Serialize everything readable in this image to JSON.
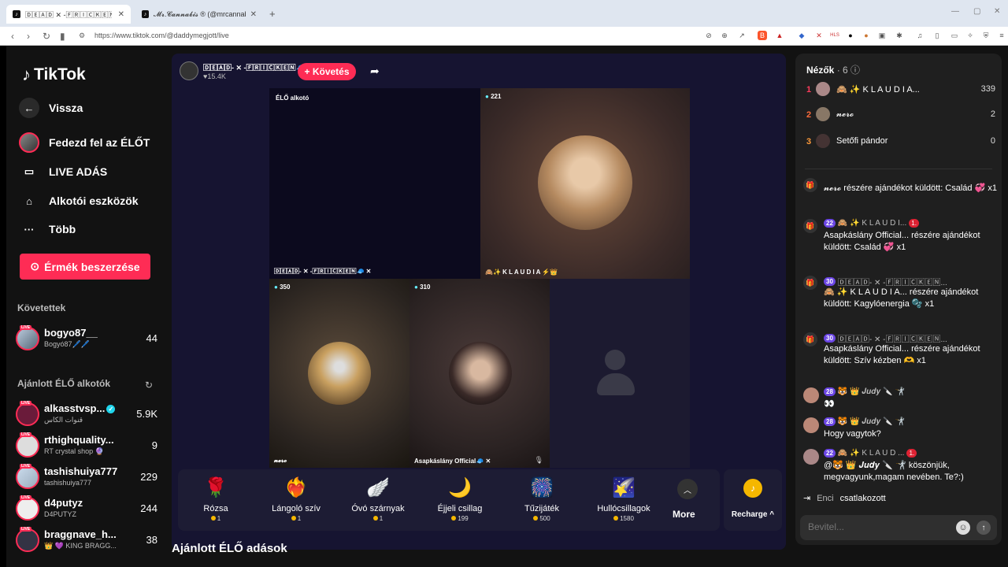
{
  "browser": {
    "tabs": [
      {
        "title": "🄳🄴🄰🄳 ✕ -🄵🅁🄸🄲🄺🄴🄽🧢 (@d"
      },
      {
        "title": "𝓜𝓻.𝓒𝓪𝓷𝓷𝓪𝓫𝓲𝓼 ® (@mrcannabis_"
      }
    ],
    "new_tab": "+",
    "url": "https://www.tiktok.com/@daddymegjott/live"
  },
  "sidebar": {
    "logo": "TikTok",
    "menu": [
      {
        "label": "Vissza",
        "icon": "back-arrow-icon"
      },
      {
        "label": "Fedezd fel az ÉLŐT",
        "icon": "avatar"
      },
      {
        "label": "LIVE ADÁS",
        "icon": "camera-icon"
      },
      {
        "label": "Alkotói eszközök",
        "icon": "creator-tools-icon"
      },
      {
        "label": "Több",
        "icon": "more-icon"
      }
    ],
    "coins_button": "Érmék beszerzése",
    "followed_title": "Követettek",
    "followed": [
      {
        "name": "bogyo87__",
        "sub": "Bogyó87🖊️🖊️",
        "count": "44"
      }
    ],
    "recommended_title": "Ajánlott ÉLŐ alkotók",
    "recommended": [
      {
        "name": "alkasstvsp...",
        "sub": "قنوات الكاس",
        "count": "5.9K",
        "verified": true
      },
      {
        "name": "rthighquality...",
        "sub": "RT crystal shop 🔮",
        "count": "9"
      },
      {
        "name": "tashishuiya777",
        "sub": "tashishuiya777",
        "count": "229"
      },
      {
        "name": "d4putyz",
        "sub": "D4PUTYZ",
        "count": "244"
      },
      {
        "name": "braggnave_h...",
        "sub": "👑 💜 KING BRAGG...",
        "count": "38"
      }
    ]
  },
  "stream": {
    "host_name": "🄳🄴🄰🄳- ✕ -🄵🅁🄸🄲🄺🄴🄽🧢 ✕",
    "host_likes": "15.4K",
    "follow_label": "+ Követés",
    "creator_label": "ÉLŐ alkotó",
    "host_tag": "🄳🄴🄰🄳- ✕ -🄵🅁🄸🄲🄺🄴🄽🧢 ✕",
    "guests": [
      {
        "count": "221",
        "name": "🙈✨ K L A U D I A ⚡👑"
      },
      {
        "count": "350",
        "name": "𝓷𝓮𝓻𝓸"
      },
      {
        "count": "310",
        "name": "Asapkáslány Official🧢 ✕"
      }
    ]
  },
  "gifts": {
    "items": [
      {
        "name": "Rózsa",
        "price": "1",
        "icon": "🌹"
      },
      {
        "name": "Lángoló szív",
        "price": "1",
        "icon": "❤️‍🔥"
      },
      {
        "name": "Óvó szárnyak",
        "price": "1",
        "icon": "🪽"
      },
      {
        "name": "Éjjeli csillag",
        "price": "199",
        "icon": "🌙"
      },
      {
        "name": "Tűzijáték",
        "price": "500",
        "icon": "🎆"
      },
      {
        "name": "Hullócsillagok",
        "price": "1580",
        "icon": "🌠"
      }
    ],
    "more_label": "More",
    "recharge_label": "Recharge ^"
  },
  "below_title": "Ajánlott ÉLŐ adások",
  "chat": {
    "viewers_title": "Nézők",
    "viewers_count": "· 6",
    "viewers": [
      {
        "rank": "1",
        "name": "🙈 ✨ K L A U D I A...",
        "score": "339",
        "color": "#ff3b5c"
      },
      {
        "rank": "2",
        "name": "𝓷𝓮𝓻𝓸",
        "score": "2",
        "color": "#ff6b3b"
      },
      {
        "rank": "3",
        "name": "Setőfi pándor",
        "score": "0",
        "color": "#ff9b3b"
      }
    ],
    "messages": [
      {
        "type": "gift",
        "head": "",
        "body": "𝓷𝓮𝓻𝓸 részére ajándékot küldött: Család 💞 x1"
      },
      {
        "type": "gift",
        "level": "22",
        "head": "🙈 ✨ K L A U D I...",
        "rank": "1.",
        "body": "Asapkáslány Official... részére ajándékot küldött: Család 💞 x1"
      },
      {
        "type": "gift",
        "level": "30",
        "head": "🄳🄴🄰🄳- ✕ -🄵🅁🄸🄲🄺🄴🄽...",
        "body": "🙈 ✨ K L A U D I A... részére ajándékot küldött: Kagylóenergia 🫧 x1"
      },
      {
        "type": "gift",
        "level": "30",
        "head": "🄳🄴🄰🄳- ✕ -🄵🅁🄸🄲🄺🄴🄽...",
        "body": "Asapkáslány Official... részére ajándékot küldött: Szív kézben 🫶 x1"
      },
      {
        "type": "chat",
        "level": "28",
        "head": "🐯 👑 𝑱𝒖𝒅𝒚 🔪 🤺",
        "body": "👀"
      },
      {
        "type": "chat",
        "level": "28",
        "head": "🐯 👑 𝑱𝒖𝒅𝒚 🔪 🤺",
        "body": "Hogy vagytok?"
      },
      {
        "type": "chat",
        "level": "22",
        "head": "🙈 ✨ K L A U D ...",
        "rank": "1.",
        "body": "@🐯 👑 𝑱𝒖𝒅𝒚 🔪 🤺 köszönjük, megvagyunk,magam nevében. Te?:)"
      }
    ],
    "joined_name": "Enci",
    "joined_text": "csatlakozott",
    "input_placeholder": "Bevitel..."
  }
}
